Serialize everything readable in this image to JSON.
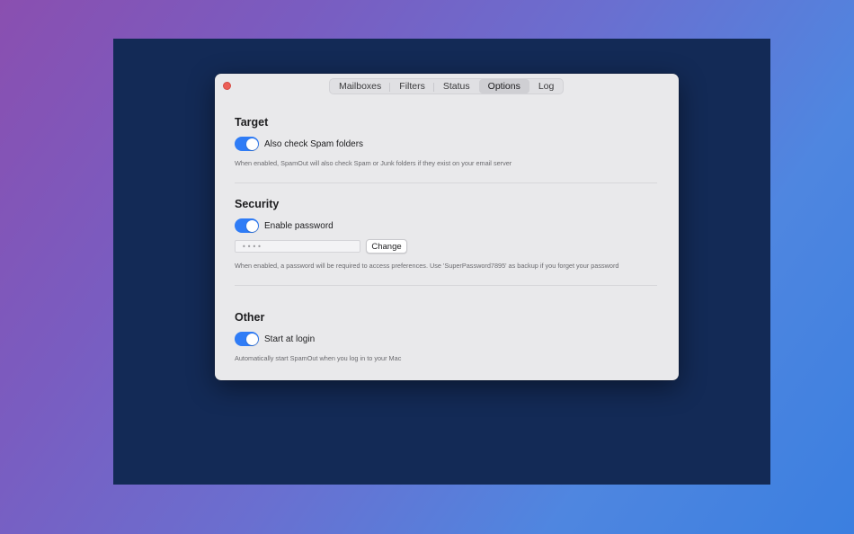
{
  "tabs": [
    {
      "label": "Mailboxes",
      "active": false
    },
    {
      "label": "Filters",
      "active": false
    },
    {
      "label": "Status",
      "active": false
    },
    {
      "label": "Options",
      "active": true
    },
    {
      "label": "Log",
      "active": false
    }
  ],
  "target": {
    "title": "Target",
    "toggle_label": "Also check Spam folders",
    "toggle_on": true,
    "hint": "When enabled, SpamOut will also check Spam or Junk folders if they exist on your email server"
  },
  "security": {
    "title": "Security",
    "toggle_label": "Enable password",
    "toggle_on": true,
    "password_value": "••••",
    "change_label": "Change",
    "hint": "When enabled, a password will be required to access preferences. Use 'SuperPassword7895' as backup if you forget your password"
  },
  "other": {
    "title": "Other",
    "toggle_label": "Start at login",
    "toggle_on": true,
    "hint": "Automatically start SpamOut when you log in to your Mac"
  },
  "colors": {
    "accent": "#2f7cf6",
    "close": "#ec5f57",
    "backdrop": "#132a56"
  }
}
